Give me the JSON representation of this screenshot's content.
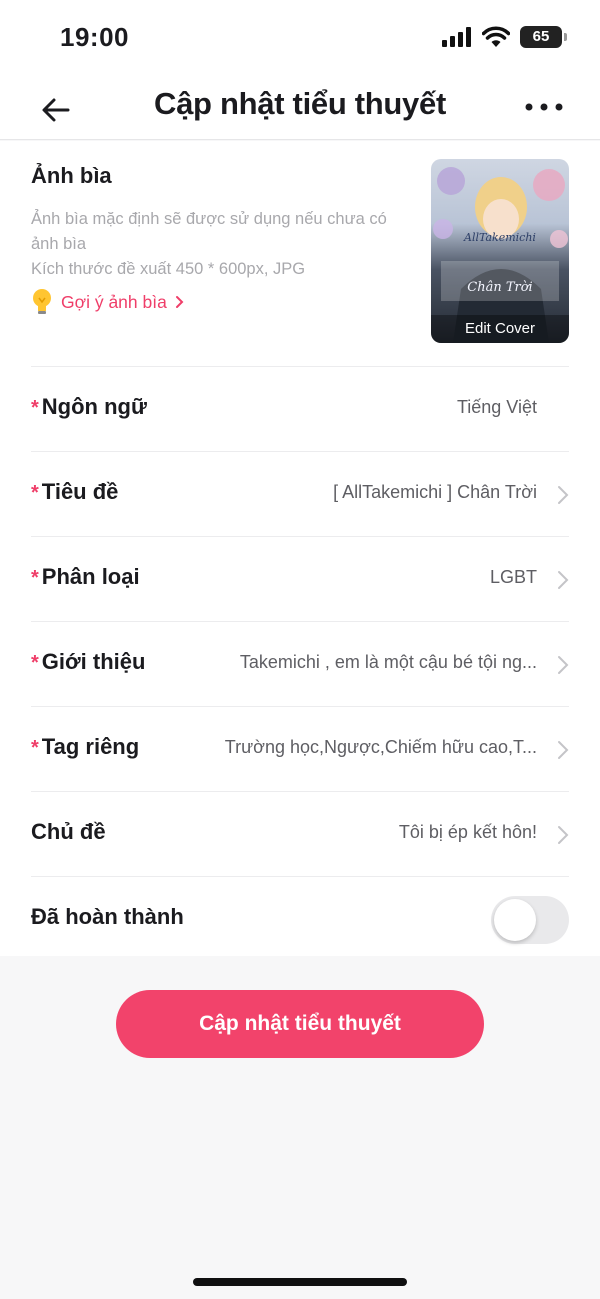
{
  "status_bar": {
    "time": "19:00",
    "battery": "65"
  },
  "header": {
    "title": "Cập nhật tiểu thuyết",
    "back_icon": "arrow-left-icon",
    "more_icon": "ellipsis-icon"
  },
  "cover": {
    "label": "Ảnh bìa",
    "description": "Ảnh bìa mặc định sẽ được sử dụng nếu chưa có ảnh bìa",
    "size_hint": "Kích thước đề xuất 450 * 600px, JPG",
    "suggest_link": "Gợi ý ảnh bìa",
    "edit_label": "Edit Cover",
    "art_title": "AllTakemichi",
    "art_subtitle": "Chân Trời"
  },
  "fields": [
    {
      "label": "Ngôn ngữ",
      "value": "Tiếng Việt",
      "required": true
    },
    {
      "label": "Tiêu đề",
      "value": "[ AllTakemichi ] Chân Trời",
      "required": true
    },
    {
      "label": "Phân loại",
      "value": "LGBT",
      "required": true
    },
    {
      "label": "Giới thiệu",
      "value": "Takemichi , em là một cậu bé tội ng...",
      "required": true
    },
    {
      "label": "Tag riêng",
      "value": "Trường học,Ngược,Chiếm hữu cao,T...",
      "required": true
    },
    {
      "label": "Chủ đề",
      "value": "Tôi bị ép kết hôn!",
      "required": false
    }
  ],
  "completed": {
    "label": "Đã hoàn thành",
    "on": false
  },
  "submit_label": "Cập nhật tiểu thuyết",
  "colors": {
    "accent": "#f2436b",
    "required_mark": "#ef3e69",
    "toggle_off": "#e9e9eb"
  }
}
